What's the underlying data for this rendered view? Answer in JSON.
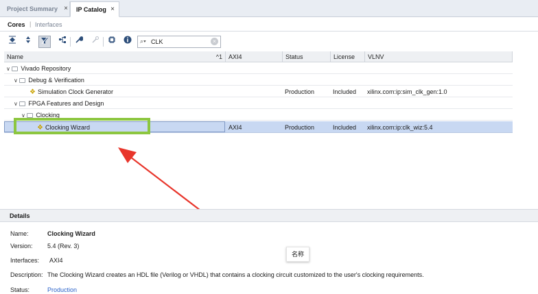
{
  "tabs": [
    {
      "label": "Project Summary",
      "close": "×"
    },
    {
      "label": "IP Catalog",
      "close": "×"
    }
  ],
  "subtabs": {
    "cores": "Cores",
    "separator": "|",
    "interfaces": "Interfaces"
  },
  "toolbar": {
    "icons": [
      "collapse-all-icon",
      "expand-all-icon",
      "filter-icon",
      "hierarchy-icon",
      "wrench-icon",
      "link-icon",
      "chip-icon",
      "info-icon"
    ],
    "search_value": "CLK"
  },
  "table": {
    "columns": [
      "Name",
      "AXI4",
      "Status",
      "License",
      "VLNV"
    ],
    "sort_indicator": "^1",
    "rows": [
      {
        "name": "Vivado Repository",
        "axi4": "",
        "status": "",
        "license": "",
        "vlnv": ""
      },
      {
        "name": "Debug & Verification",
        "axi4": "",
        "status": "",
        "license": "",
        "vlnv": ""
      },
      {
        "name": "Simulation Clock Generator",
        "axi4": "",
        "status": "Production",
        "license": "Included",
        "vlnv": "xilinx.com:ip:sim_clk_gen:1.0"
      },
      {
        "name": "FPGA Features and Design",
        "axi4": "",
        "status": "",
        "license": "",
        "vlnv": ""
      },
      {
        "name": "Clocking",
        "axi4": "",
        "status": "",
        "license": "",
        "vlnv": ""
      },
      {
        "name": "Clocking Wizard",
        "axi4": "AXI4",
        "status": "Production",
        "license": "Included",
        "vlnv": "xilinx.com:ip:clk_wiz:5.4"
      }
    ]
  },
  "details": {
    "title": "Details",
    "name_label": "Name:",
    "name_value": "Clocking Wizard",
    "version_label": "Version:",
    "version_value": "5.4 (Rev. 3)",
    "interfaces_label": "Interfaces:",
    "interfaces_value": "AXI4",
    "description_label": "Description:",
    "description_value": "The Clocking Wizard creates an HDL file (Verilog or VHDL) that contains a clocking circuit customized to the user's clocking requirements.",
    "status_label": "Status:",
    "status_value": "Production"
  },
  "tooltip": "名称",
  "colors": {
    "highlight": "#8cc63f",
    "arrow": "#e8352b",
    "selected_row": "#c8d8f2",
    "link": "#2a62c9"
  }
}
